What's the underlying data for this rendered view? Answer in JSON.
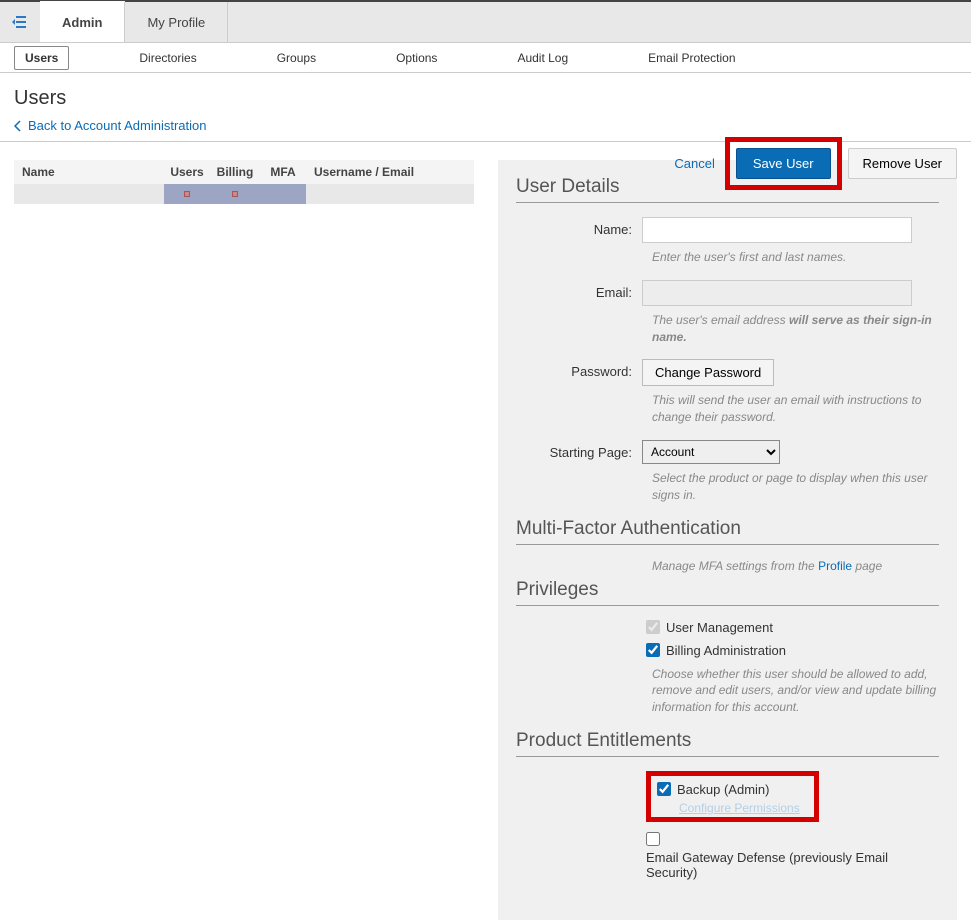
{
  "topTabs": {
    "admin": "Admin",
    "profile": "My Profile"
  },
  "subnav": [
    "Users",
    "Directories",
    "Groups",
    "Options",
    "Audit Log",
    "Email Protection"
  ],
  "page": {
    "title": "Users",
    "back": "Back to Account Administration"
  },
  "actions": {
    "cancel": "Cancel",
    "save": "Save User",
    "remove": "Remove User"
  },
  "table": {
    "headers": {
      "name": "Name",
      "users": "Users",
      "billing": "Billing",
      "mfa": "MFA",
      "username": "Username / Email"
    }
  },
  "sections": {
    "details": "User Details",
    "mfa": "Multi-Factor Authentication",
    "priv": "Privileges",
    "ent": "Product Entitlements"
  },
  "form": {
    "nameLabel": "Name:",
    "nameHint": "Enter the user's first and last names.",
    "emailLabel": "Email:",
    "emailHint1": "The user's email address ",
    "emailHint2": "will serve as their sign-in name.",
    "pwLabel": "Password:",
    "pwBtn": "Change Password",
    "pwHint": "This will send the user an email with instructions to change their password.",
    "startLabel": "Starting Page:",
    "startValue": "Account",
    "startHint": "Select the product or page to display when this user signs in."
  },
  "mfaHint": {
    "pre": "Manage MFA settings from the ",
    "link": "Profile",
    "post": " page"
  },
  "priv": {
    "userMgmt": "User Management",
    "billing": "Billing Administration",
    "hint": "Choose whether this user should be allowed to add, remove and edit users, and/or view and update billing information for this account."
  },
  "ent": {
    "backup": "Backup (Admin)",
    "configure": "Configure Permissions",
    "egd": "Email Gateway Defense (previously Email Security)"
  }
}
